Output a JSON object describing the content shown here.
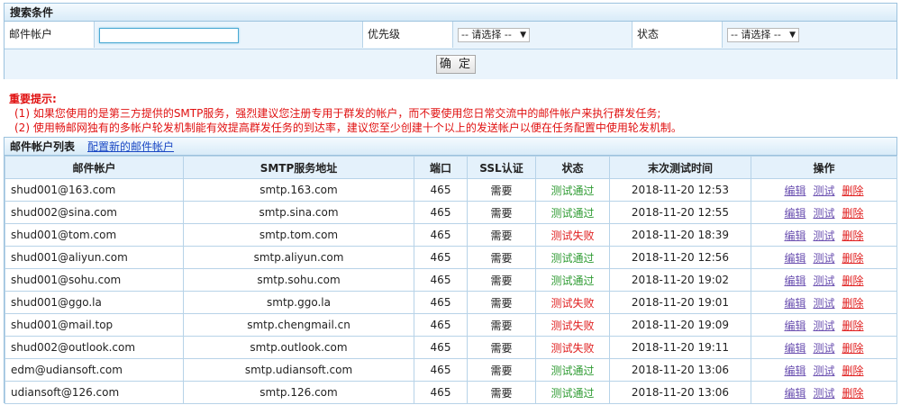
{
  "search": {
    "title": "搜索条件",
    "account_label": "邮件帐户",
    "account_value": "",
    "priority_label": "优先级",
    "priority_select": "-- 请选择 --",
    "status_label": "状态",
    "status_select": "-- 请选择 --",
    "confirm_label": "确 定"
  },
  "notice": {
    "title": "重要提示:",
    "line1": "(1) 如果您使用的是第三方提供的SMTP服务，强烈建议您注册专用于群发的帐户，而不要使用您日常交流中的邮件帐户来执行群发任务;",
    "line2": "(2) 使用畅邮网独有的多帐户轮发机制能有效提高群发任务的到达率，建议您至少创建十个以上的发送帐户以便在任务配置中使用轮发机制。"
  },
  "list": {
    "title": "邮件帐户列表",
    "config_link": "配置新的邮件帐户",
    "columns": [
      "邮件帐户",
      "SMTP服务地址",
      "端口",
      "SSL认证",
      "状态",
      "末次测试时间",
      "操作"
    ],
    "actions": {
      "edit": "编辑",
      "test": "测试",
      "delete": "删除"
    },
    "status_colors": {
      "ok": "#2e9b32",
      "fail": "#e02020"
    },
    "rows": [
      {
        "email": "shud001@163.com",
        "smtp": "smtp.163.com",
        "port": "465",
        "ssl": "需要",
        "status": "测试通过",
        "ok": true,
        "time": "2018-11-20 12:53"
      },
      {
        "email": "shud002@sina.com",
        "smtp": "smtp.sina.com",
        "port": "465",
        "ssl": "需要",
        "status": "测试通过",
        "ok": true,
        "time": "2018-11-20 12:55"
      },
      {
        "email": "shud001@tom.com",
        "smtp": "smtp.tom.com",
        "port": "465",
        "ssl": "需要",
        "status": "测试失败",
        "ok": false,
        "time": "2018-11-20 18:39"
      },
      {
        "email": "shud001@aliyun.com",
        "smtp": "smtp.aliyun.com",
        "port": "465",
        "ssl": "需要",
        "status": "测试通过",
        "ok": true,
        "time": "2018-11-20 12:56"
      },
      {
        "email": "shud001@sohu.com",
        "smtp": "smtp.sohu.com",
        "port": "465",
        "ssl": "需要",
        "status": "测试通过",
        "ok": true,
        "time": "2018-11-20 19:02"
      },
      {
        "email": "shud001@ggo.la",
        "smtp": "smtp.ggo.la",
        "port": "465",
        "ssl": "需要",
        "status": "测试失败",
        "ok": false,
        "time": "2018-11-20 19:01"
      },
      {
        "email": "shud001@mail.top",
        "smtp": "smtp.chengmail.cn",
        "port": "465",
        "ssl": "需要",
        "status": "测试失败",
        "ok": false,
        "time": "2018-11-20 19:09"
      },
      {
        "email": "shud002@outlook.com",
        "smtp": "smtp.outlook.com",
        "port": "465",
        "ssl": "需要",
        "status": "测试失败",
        "ok": false,
        "time": "2018-11-20 19:11"
      },
      {
        "email": "edm@udiansoft.com",
        "smtp": "smtp.udiansoft.com",
        "port": "465",
        "ssl": "需要",
        "status": "测试通过",
        "ok": true,
        "time": "2018-11-20 13:06"
      },
      {
        "email": "udiansoft@126.com",
        "smtp": "smtp.126.com",
        "port": "465",
        "ssl": "需要",
        "status": "测试通过",
        "ok": true,
        "time": "2018-11-20 13:06"
      }
    ]
  }
}
